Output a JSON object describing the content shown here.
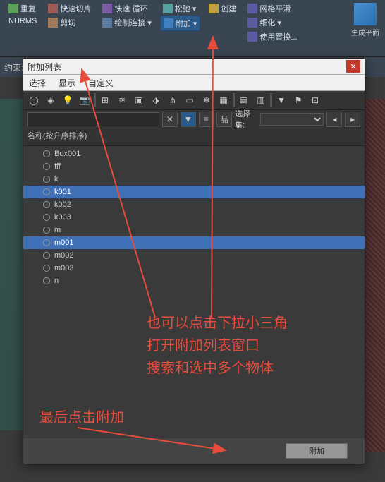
{
  "ribbon": {
    "reset": "重复",
    "quick_slice": "快速切片",
    "nurms": "NURMS",
    "cut": "剪切",
    "quick_loop": "快速 循环",
    "draw_connect": "绘制连接",
    "relax": "松弛",
    "attach": "附加",
    "create": "创建",
    "mesh_smooth": "网格平滑",
    "refine": "细化",
    "use_swap": "使用置换...",
    "gen_plane": "生成平面",
    "constraint": "约束:"
  },
  "dialog": {
    "title": "附加列表",
    "menu": {
      "select": "选择",
      "display": "显示",
      "custom": "自定义"
    },
    "search_placeholder": "",
    "selection_set": "选择集:",
    "list_header": "名称(按升序排序)",
    "items": [
      {
        "name": "Box001",
        "sel": false
      },
      {
        "name": "fff",
        "sel": false
      },
      {
        "name": "k",
        "sel": false
      },
      {
        "name": "k001",
        "sel": true
      },
      {
        "name": "k002",
        "sel": false
      },
      {
        "name": "k003",
        "sel": false
      },
      {
        "name": "m",
        "sel": false
      },
      {
        "name": "m001",
        "sel": true
      },
      {
        "name": "m002",
        "sel": false
      },
      {
        "name": "m003",
        "sel": false
      },
      {
        "name": "n",
        "sel": false
      }
    ],
    "attach_btn": "附加"
  },
  "annotations": {
    "a1": "也可以点击下拉小三角\n打开附加列表窗口\n搜索和选中多个物体",
    "a2": "最后点击附加"
  }
}
